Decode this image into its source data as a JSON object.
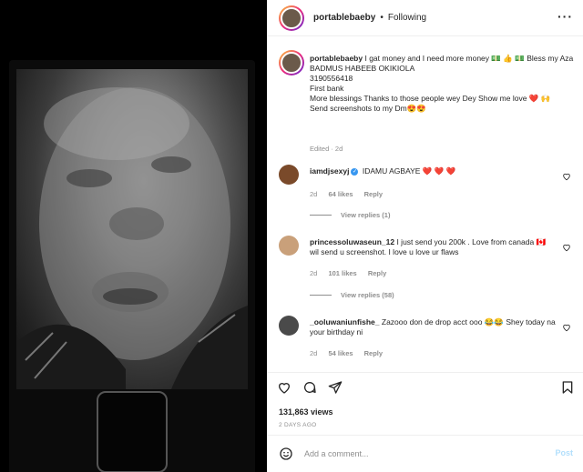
{
  "header": {
    "username": "portablebaeby",
    "separator": "•",
    "follow_status": "Following",
    "more": "···"
  },
  "caption": {
    "username": "portablebaeby",
    "line1": "I gat money and I need more money 💵 👍 💵 Bless my Aza BADMUS HABEEB OKIKIOLA",
    "line2": "3190556418",
    "line3": "First bank",
    "line4": "More blessings Thanks to those people wey Dey Show me love ❤️ 🙌",
    "line5": "Send screenshots to my Dm😍😍",
    "meta": "Edited · 2d"
  },
  "comments": [
    {
      "username": "iamdjsexyj",
      "verified": true,
      "text": "IDAMU AGBAYE ❤️ ❤️ ❤️",
      "time": "2d",
      "likes": "64 likes",
      "reply": "Reply",
      "view_replies": "View replies (1)",
      "avatar_color": "#7a4a2a"
    },
    {
      "username": "princessoluwaseun_12",
      "verified": false,
      "text": "I just send you 200k . Love from canada 🇨🇦 wil send u screenshot. I love u love ur flaws",
      "time": "2d",
      "likes": "101 likes",
      "reply": "Reply",
      "view_replies": "View replies (58)",
      "avatar_color": "#c9a07a"
    },
    {
      "username": "_ooluwaniunfishe_",
      "verified": false,
      "text": "Zazooo don de drop acct ooo 😂😂 Shey today na your birthday ni",
      "time": "2d",
      "likes": "54 likes",
      "reply": "Reply",
      "avatar_color": "#4a4a4a"
    }
  ],
  "stats": {
    "views": "131,863 views",
    "time": "2 DAYS AGO"
  },
  "composer": {
    "placeholder": "Add a comment...",
    "post_label": "Post"
  }
}
